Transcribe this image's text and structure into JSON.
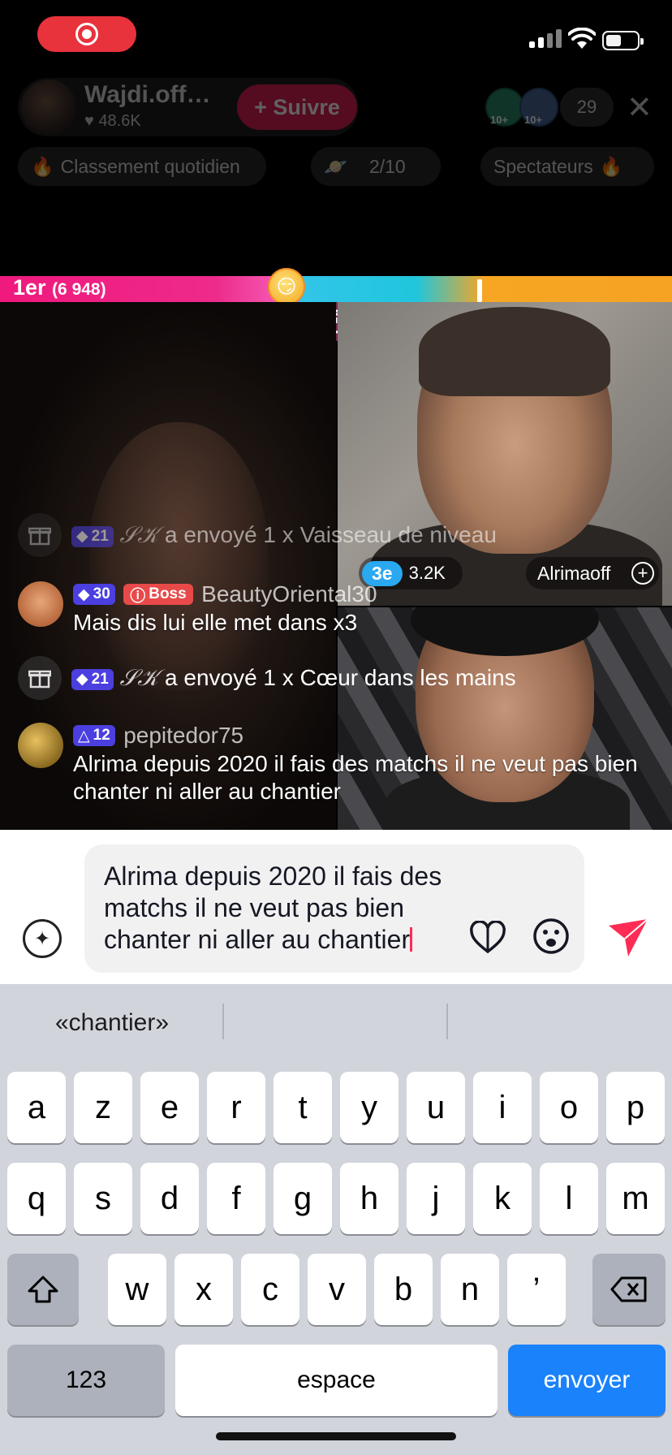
{
  "status_bar": {
    "recording_icon": "record-icon"
  },
  "host": {
    "name": "Wajdi.off…",
    "likes": "48.6K",
    "follow_label": "+ Suivre",
    "viewer_badge_1": "10+",
    "viewer_badge_2": "10+",
    "viewer_count": "29"
  },
  "pills": {
    "ranking": "Classement quotidien",
    "mission": "2/10",
    "spectators": "Spectateurs"
  },
  "battle": {
    "first_rank": "1er",
    "first_score": "(6 948)",
    "opponent_rank": "3e",
    "opponent_score": "3.2K",
    "opponent_name": "Alrimaoff",
    "score_split_fraction": 0.44
  },
  "chat": [
    {
      "type": "gift",
      "level": "21",
      "sender": "𝒮𝒦",
      "text": "a envoyé 1 x Vaisseau de niveau"
    },
    {
      "type": "comment",
      "level": "30",
      "badge": "Boss",
      "user": "BeautyOriental30",
      "text": "Mais dis lui elle met dans x3"
    },
    {
      "type": "gift",
      "level": "21",
      "sender": "𝒮𝒦",
      "text": "a envoyé 1 x Cœur dans les mains"
    },
    {
      "type": "comment",
      "level": "12",
      "user": "pepitedor75",
      "text": "Alrima depuis 2020 il fais des matchs il ne veut pas bien chanter ni aller au chantier"
    }
  ],
  "input": {
    "value": "Alrima depuis 2020 il fais des matchs il ne veut pas bien chanter ni aller au chantier"
  },
  "keyboard": {
    "suggestion": "«chantier»",
    "row1": [
      "a",
      "z",
      "e",
      "r",
      "t",
      "y",
      "u",
      "i",
      "o",
      "p"
    ],
    "row2": [
      "q",
      "s",
      "d",
      "f",
      "g",
      "h",
      "j",
      "k",
      "l",
      "m"
    ],
    "row3": [
      "w",
      "x",
      "c",
      "v",
      "b",
      "n",
      "’"
    ],
    "numbers_label": "123",
    "space_label": "espace",
    "return_label": "envoyer"
  },
  "colors": {
    "accent": "#fe2c55",
    "follow": "#e01e55",
    "battle_left": "#f0197d",
    "battle_right": "#1fc6dc",
    "keyboard_return": "#1a82fb"
  }
}
